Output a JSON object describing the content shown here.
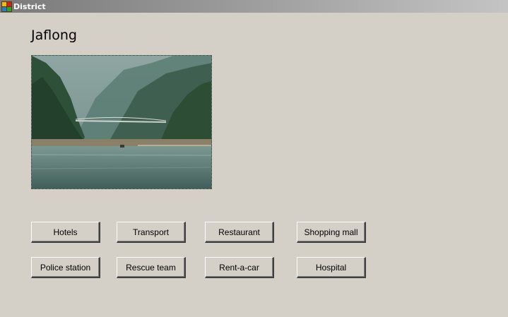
{
  "window": {
    "title": "District",
    "icon": "app-form-icon"
  },
  "place": {
    "name": "Jaflong",
    "photo_alt": "river-landscape-photo"
  },
  "buttons": {
    "hotels": "Hotels",
    "transport": "Transport",
    "restaurant": "Restaurant",
    "shopping_mall": "Shopping mall",
    "police_station": "Police station",
    "rescue_team": "Rescue team",
    "rent_a_car": "Rent-a-car",
    "hospital": "Hospital"
  },
  "colors": {
    "form_background": "#d4d0c8",
    "title_bar": "#8a8a8a"
  }
}
